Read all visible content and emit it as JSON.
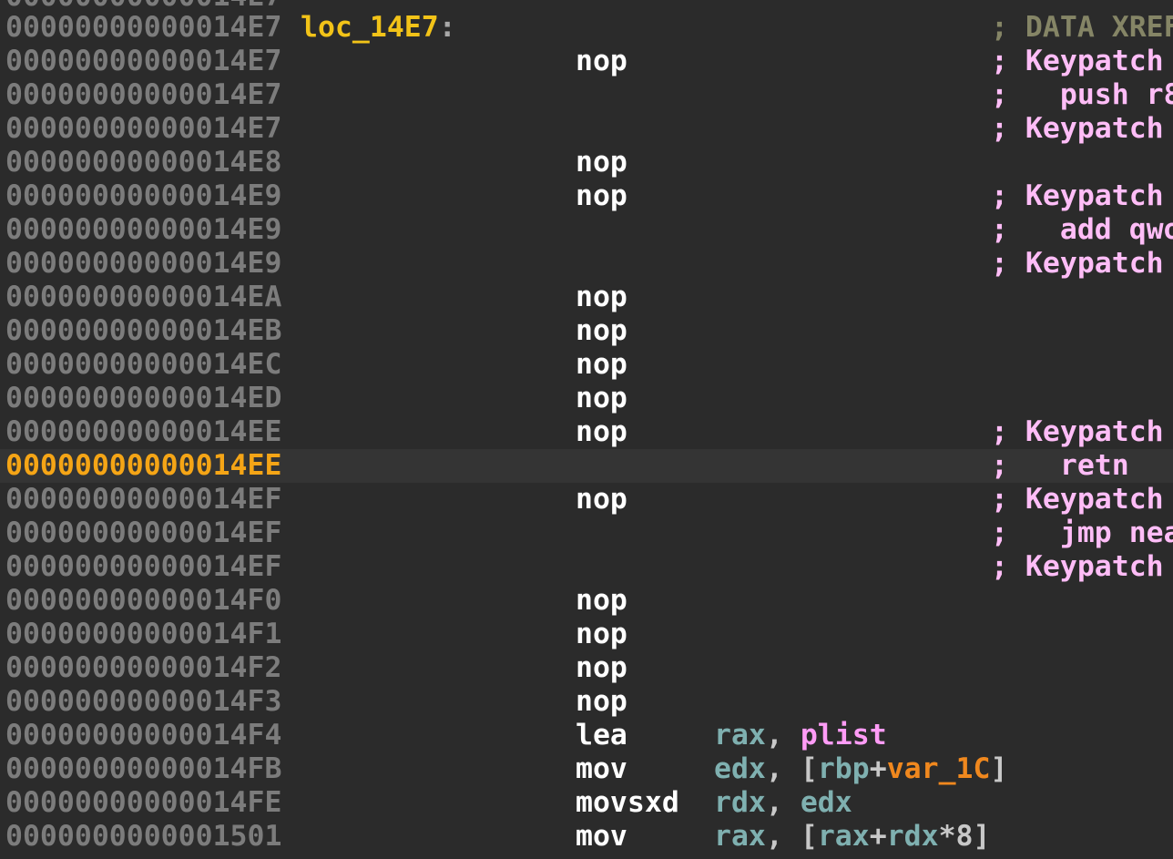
{
  "colors": {
    "background": "#2b2b2b",
    "address": "#7c7c7c",
    "current_address": "#f5a516",
    "label": "#f2c318",
    "mnemonic": "#ffffff",
    "register": "#7fb0b0",
    "symbol": "#ff9cf6",
    "variable": "#f0881e",
    "comment": "#ffbdf7",
    "xref_comment": "#858566"
  },
  "partial_top_address": "00000000000014E7",
  "rows": [
    {
      "addr": "00000000000014E7",
      "label": "loc_14E7",
      "colon": ":",
      "cmt": "; DATA XREF"
    },
    {
      "addr": "00000000000014E7",
      "mnem": "nop",
      "cmt": "; Keypatch"
    },
    {
      "addr": "00000000000014E7",
      "cmt": ";   push r8"
    },
    {
      "addr": "00000000000014E7",
      "cmt": "; Keypatch"
    },
    {
      "addr": "00000000000014E8",
      "mnem": "nop"
    },
    {
      "addr": "00000000000014E9",
      "mnem": "nop",
      "cmt": "; Keypatch"
    },
    {
      "addr": "00000000000014E9",
      "cmt": ";   add qwo"
    },
    {
      "addr": "00000000000014E9",
      "cmt": "; Keypatch"
    },
    {
      "addr": "00000000000014EA",
      "mnem": "nop"
    },
    {
      "addr": "00000000000014EB",
      "mnem": "nop"
    },
    {
      "addr": "00000000000014EC",
      "mnem": "nop"
    },
    {
      "addr": "00000000000014ED",
      "mnem": "nop"
    },
    {
      "addr": "00000000000014EE",
      "mnem": "nop",
      "cmt": "; Keypatch"
    },
    {
      "addr": "00000000000014EE",
      "cmt": ";   retn",
      "current": true
    },
    {
      "addr": "00000000000014EF",
      "mnem": "nop",
      "cmt": "; Keypatch"
    },
    {
      "addr": "00000000000014EF",
      "cmt": ";   jmp nea"
    },
    {
      "addr": "00000000000014EF",
      "cmt": "; Keypatch"
    },
    {
      "addr": "00000000000014F0",
      "mnem": "nop"
    },
    {
      "addr": "00000000000014F1",
      "mnem": "nop"
    },
    {
      "addr": "00000000000014F2",
      "mnem": "nop"
    },
    {
      "addr": "00000000000014F3",
      "mnem": "nop"
    },
    {
      "addr": "00000000000014F4",
      "mnem": "lea",
      "ops": [
        [
          "rax",
          "reg"
        ],
        [
          ", ",
          "punc"
        ],
        [
          "plist",
          "sym"
        ]
      ]
    },
    {
      "addr": "00000000000014FB",
      "mnem": "mov",
      "ops": [
        [
          "edx",
          "reg"
        ],
        [
          ", [",
          "punc"
        ],
        [
          "rbp",
          "reg"
        ],
        [
          "+",
          "punc"
        ],
        [
          "var_1C",
          "var"
        ],
        [
          "]",
          "punc"
        ]
      ]
    },
    {
      "addr": "00000000000014FE",
      "mnem": "movsxd",
      "ops": [
        [
          "rdx",
          "reg"
        ],
        [
          ", ",
          "punc"
        ],
        [
          "edx",
          "reg"
        ]
      ]
    },
    {
      "addr": "0000000000001501",
      "mnem": "mov",
      "ops": [
        [
          "rax",
          "reg"
        ],
        [
          ", [",
          "punc"
        ],
        [
          "rax",
          "reg"
        ],
        [
          "+",
          "punc"
        ],
        [
          "rdx",
          "reg"
        ],
        [
          "*8]",
          "num"
        ]
      ]
    }
  ]
}
